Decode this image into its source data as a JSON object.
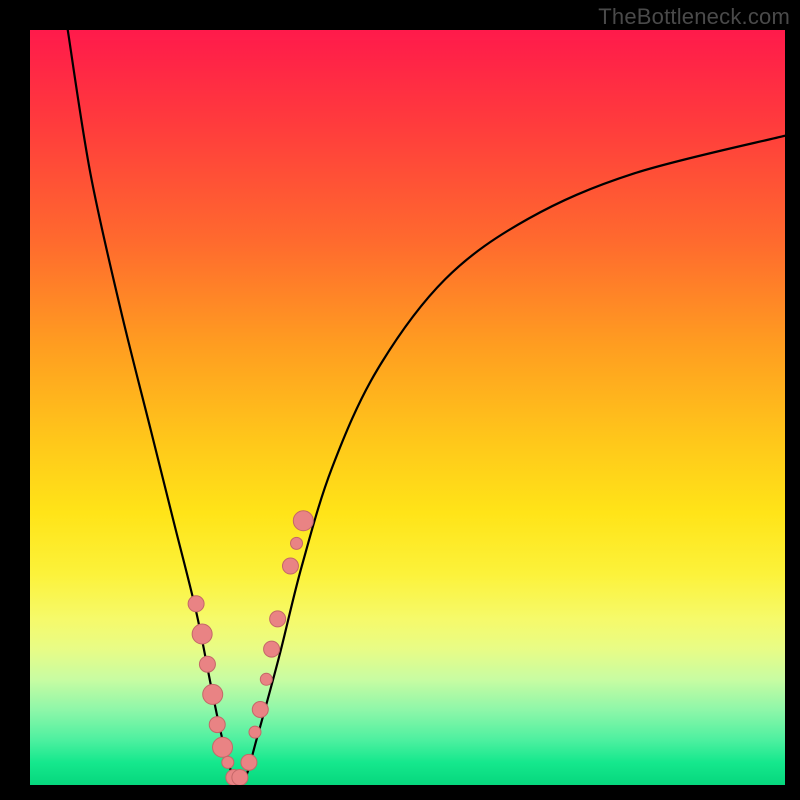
{
  "watermark": "TheBottleneck.com",
  "chart_data": {
    "type": "line",
    "title": "",
    "xlabel": "",
    "ylabel": "",
    "xlim": [
      0,
      100
    ],
    "ylim": [
      0,
      100
    ],
    "series": [
      {
        "name": "bottleneck-curve",
        "x": [
          5,
          8,
          12,
          16,
          19,
          22,
          24,
          25.5,
          27,
          28.5,
          30,
          33,
          36,
          40,
          46,
          55,
          66,
          80,
          100
        ],
        "values": [
          100,
          81,
          63,
          47,
          35,
          23,
          13,
          6,
          1,
          1,
          6,
          17,
          29,
          42,
          55,
          67,
          75,
          81,
          86
        ]
      }
    ],
    "markers": [
      {
        "series": "bottleneck-curve",
        "region": "left-dip",
        "x": [
          22.0,
          22.8,
          23.5,
          24.2,
          24.8,
          25.5,
          26.2,
          27.0,
          27.8
        ],
        "values": [
          24,
          20,
          16,
          12,
          8,
          5,
          3,
          1,
          1
        ],
        "sizes": [
          8,
          10,
          8,
          10,
          8,
          10,
          6,
          8,
          8
        ]
      },
      {
        "series": "bottleneck-curve",
        "region": "right-dip",
        "x": [
          29.0,
          29.8,
          30.5,
          31.3,
          32.0,
          32.8,
          34.5,
          35.3,
          36.2
        ],
        "values": [
          3,
          7,
          10,
          14,
          18,
          22,
          29,
          32,
          35
        ],
        "sizes": [
          8,
          6,
          8,
          6,
          8,
          8,
          8,
          6,
          10
        ]
      }
    ],
    "gradient_bands": [
      {
        "stop": 0,
        "color": "#ff1a4b"
      },
      {
        "stop": 12,
        "color": "#ff3a3d"
      },
      {
        "stop": 28,
        "color": "#ff6a2e"
      },
      {
        "stop": 42,
        "color": "#ff9e20"
      },
      {
        "stop": 55,
        "color": "#ffc91a"
      },
      {
        "stop": 64,
        "color": "#ffe418"
      },
      {
        "stop": 72,
        "color": "#fcf23a"
      },
      {
        "stop": 78,
        "color": "#f6fa6a"
      },
      {
        "stop": 82,
        "color": "#e8fc86"
      },
      {
        "stop": 86,
        "color": "#c8fca2"
      },
      {
        "stop": 90,
        "color": "#8ff7a9"
      },
      {
        "stop": 94,
        "color": "#4ef0a0"
      },
      {
        "stop": 97,
        "color": "#15e88d"
      },
      {
        "stop": 100,
        "color": "#06d77d"
      }
    ],
    "colors": {
      "curve": "#000000",
      "marker_fill": "#e98384",
      "marker_stroke": "#c46768",
      "background_frame": "#000000"
    }
  }
}
